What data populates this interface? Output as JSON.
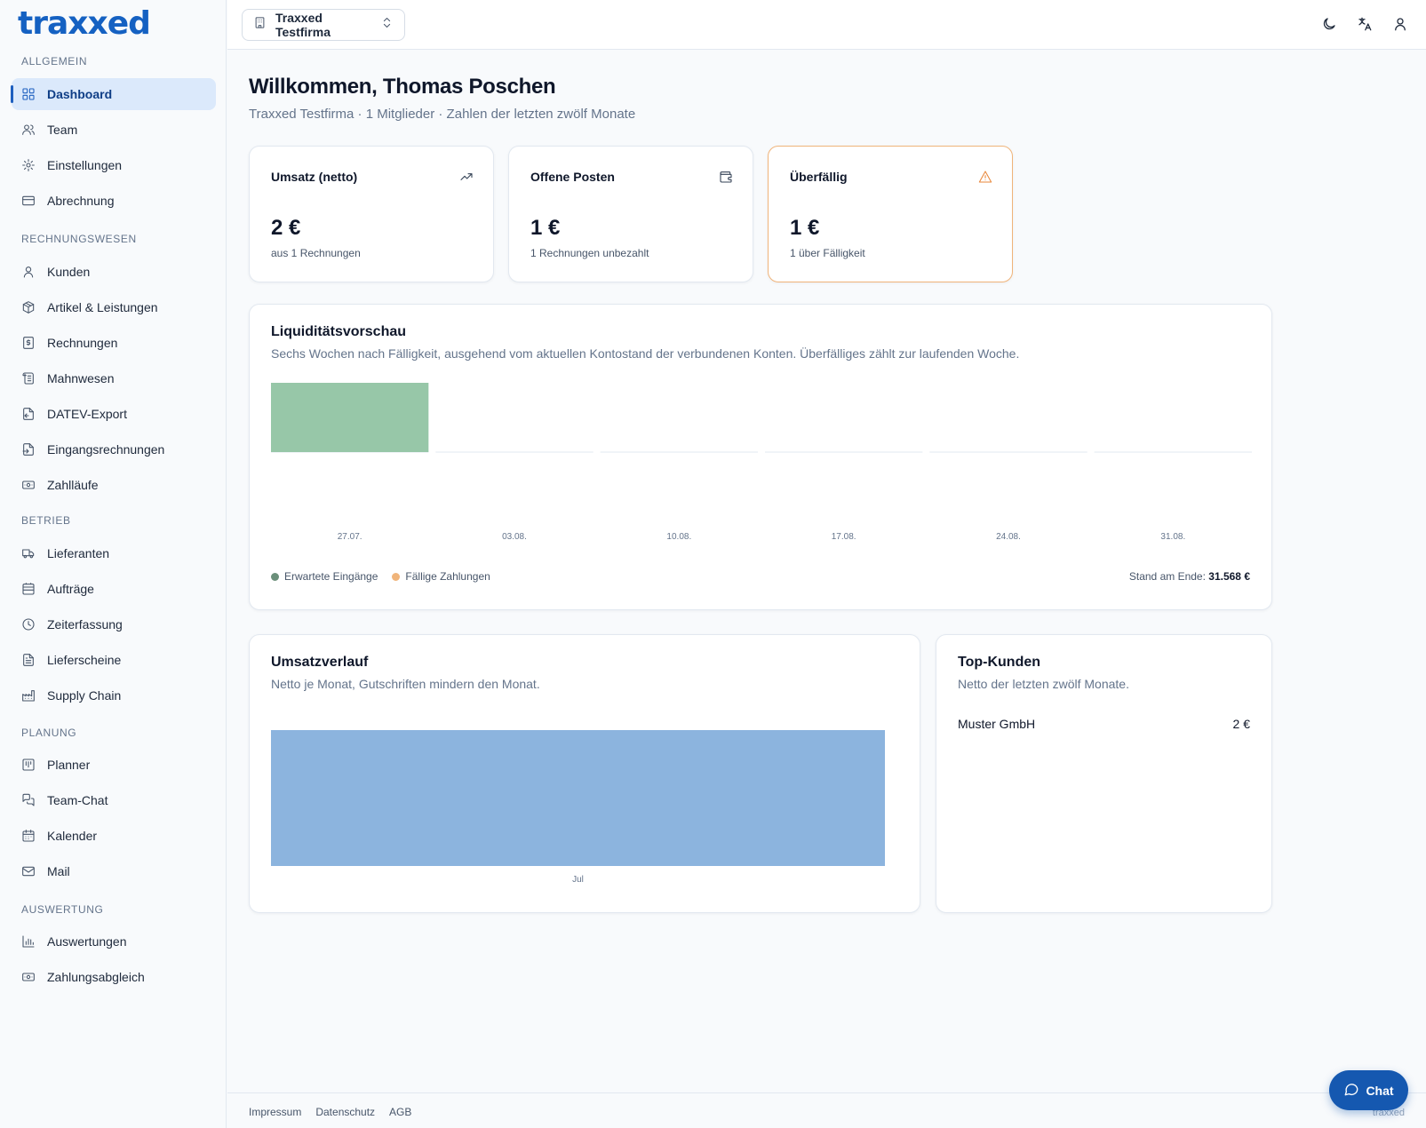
{
  "brand": {
    "logo_text": "traxxed",
    "accent": "#1561c2"
  },
  "sidebar": {
    "sections": [
      {
        "title": "ALLGEMEIN",
        "items": [
          {
            "label": "Dashboard",
            "icon": "dashboard-icon",
            "active": true
          },
          {
            "label": "Team",
            "icon": "users-icon"
          },
          {
            "label": "Einstellungen",
            "icon": "gear-icon"
          },
          {
            "label": "Abrechnung",
            "icon": "credit-card-icon"
          }
        ]
      },
      {
        "title": "RECHNUNGSWESEN",
        "items": [
          {
            "label": "Kunden",
            "icon": "user-icon"
          },
          {
            "label": "Artikel & Leistungen",
            "icon": "package-icon"
          },
          {
            "label": "Rechnungen",
            "icon": "receipt-icon"
          },
          {
            "label": "Mahnwesen",
            "icon": "scroll-icon"
          },
          {
            "label": "DATEV-Export",
            "icon": "file-export-icon"
          },
          {
            "label": "Eingangsrechnungen",
            "icon": "file-import-icon"
          },
          {
            "label": "Zahlläufe",
            "icon": "banknote-icon"
          }
        ]
      },
      {
        "title": "BETRIEB",
        "items": [
          {
            "label": "Lieferanten",
            "icon": "truck-icon"
          },
          {
            "label": "Aufträge",
            "icon": "clipboard-icon"
          },
          {
            "label": "Zeiterfassung",
            "icon": "clock-icon"
          },
          {
            "label": "Lieferscheine",
            "icon": "file-text-icon"
          },
          {
            "label": "Supply Chain",
            "icon": "factory-icon"
          }
        ]
      },
      {
        "title": "PLANUNG",
        "items": [
          {
            "label": "Planner",
            "icon": "kanban-icon"
          },
          {
            "label": "Team-Chat",
            "icon": "messages-icon"
          },
          {
            "label": "Kalender",
            "icon": "calendar-icon"
          },
          {
            "label": "Mail",
            "icon": "mail-icon"
          }
        ]
      },
      {
        "title": "AUSWERTUNG",
        "items": [
          {
            "label": "Auswertungen",
            "icon": "bar-chart-icon"
          },
          {
            "label": "Zahlungsabgleich",
            "icon": "banknote-icon"
          }
        ]
      }
    ]
  },
  "topbar": {
    "company": "Traxxed Testfirma",
    "icons": [
      "moon-icon",
      "translate-icon",
      "user-icon"
    ]
  },
  "header": {
    "title": "Willkommen, Thomas Poschen",
    "subtitle": "Traxxed Testfirma · 1 Mitglieder · Zahlen der letzten zwölf Monate"
  },
  "kpis": [
    {
      "title": "Umsatz (netto)",
      "value": "2 €",
      "note": "aus 1 Rechnungen",
      "icon": "trending-up-icon",
      "icon_color": "#334155"
    },
    {
      "title": "Offene Posten",
      "value": "1 €",
      "note": "1 Rechnungen unbezahlt",
      "icon": "wallet-icon",
      "icon_color": "#334155"
    },
    {
      "title": "Überfällig",
      "value": "1 €",
      "note": "1 über Fälligkeit",
      "icon": "alert-triangle-icon",
      "icon_color": "#e8873a",
      "highlight": true
    }
  ],
  "liquidity": {
    "title": "Liquiditätsvorschau",
    "subtitle": "Sechs Wochen nach Fälligkeit, ausgehend vom aktuellen Kontostand der verbundenen Konten. Überfälliges zählt zur laufenden Woche.",
    "legend": [
      {
        "label": "Erwartete Eingänge",
        "color": "#6b8f7a"
      },
      {
        "label": "Fällige Zahlungen",
        "color": "#f0b47a"
      }
    ],
    "stand_label": "Stand am Ende:",
    "stand_value": "31.568 €"
  },
  "revenue": {
    "title": "Umsatzverlauf",
    "subtitle": "Netto je Monat, Gutschriften mindern den Monat."
  },
  "top_customers": {
    "title": "Top-Kunden",
    "subtitle": "Netto der letzten zwölf Monate.",
    "rows": [
      {
        "name": "Muster GmbH",
        "value": "2 €"
      }
    ]
  },
  "chart_data": [
    {
      "type": "bar",
      "categories": [
        "27.07.",
        "03.08.",
        "10.08.",
        "17.08.",
        "24.08.",
        "31.08."
      ],
      "series": [
        {
          "name": "Erwartete Eingänge",
          "values": [
            1,
            0,
            0,
            0,
            0,
            0
          ],
          "color": "#97c7a8"
        },
        {
          "name": "Fällige Zahlungen",
          "values": [
            0,
            0,
            0,
            0,
            0,
            0
          ],
          "color": "#f0b47a"
        }
      ]
    },
    {
      "type": "bar",
      "categories": [
        "Jul"
      ],
      "values": [
        2
      ],
      "color": "#8cb4de"
    }
  ],
  "footer": {
    "links": [
      "Impressum",
      "Datenschutz",
      "AGB"
    ],
    "brand": "traxxed"
  },
  "chat": {
    "label": "Chat"
  }
}
